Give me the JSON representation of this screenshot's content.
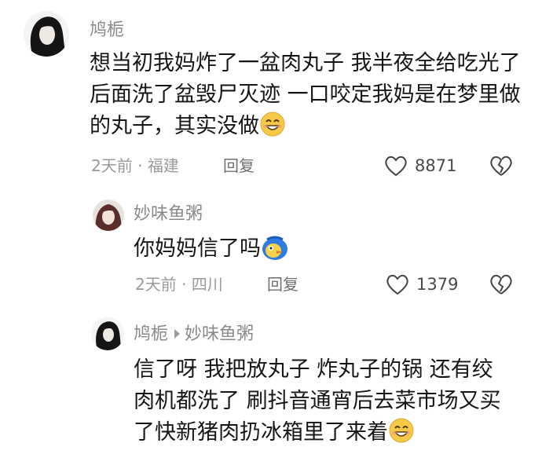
{
  "comments": [
    {
      "username": "鸠栀",
      "text": "想当初我妈炸了一盆肉丸子 我半夜全给吃光了 后面洗了盆毁尸灭迹 一口咬定我妈是在梦里做的丸子，其实没做",
      "time": "2天前",
      "location": "福建",
      "reply_label": "回复",
      "likes": "8871"
    },
    {
      "username": "妙味鱼粥",
      "text": "你妈妈信了吗",
      "time": "2天前",
      "location": "四川",
      "reply_label": "回复",
      "likes": "1379"
    },
    {
      "username": "鸠栀",
      "reply_to": "妙味鱼粥",
      "text": "信了呀 我把放丸子 炸丸子的锅 还有绞肉机都洗了 刷抖音通宵后去菜市场又买了快新猪肉扔冰箱里了来着"
    }
  ],
  "icons": {
    "like": "heart-outline-icon",
    "dislike": "broken-heart-icon",
    "emoji": "smile-emoji-icon",
    "sticker": "blue-bird-sticker-icon"
  },
  "colors": {
    "meta": "#9a9a9a",
    "text": "#161616",
    "emoji": "#f7c948"
  }
}
